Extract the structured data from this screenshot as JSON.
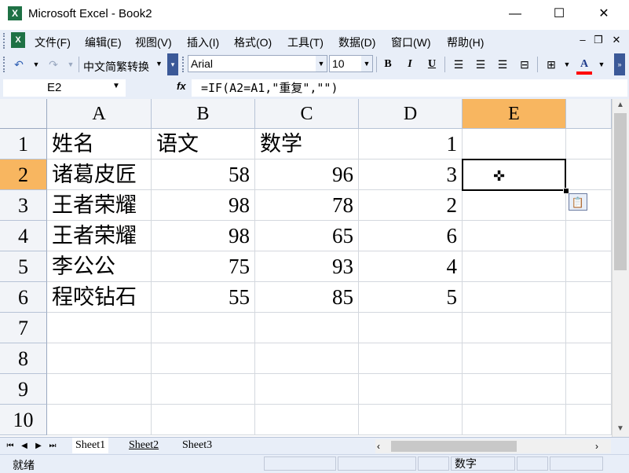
{
  "window": {
    "title": "Microsoft Excel - Book2",
    "app_icon": "excel-icon",
    "minimize_glyph": "—",
    "maximize_glyph": "☐",
    "close_glyph": "✕"
  },
  "menubar": {
    "items": [
      "文件(F)",
      "编辑(E)",
      "视图(V)",
      "插入(I)",
      "格式(O)",
      "工具(T)",
      "数据(D)",
      "窗口(W)",
      "帮助(H)"
    ]
  },
  "toolbar": {
    "undo_glyph": "↶",
    "redo_glyph": "↷",
    "convert_label": "中文简繁转换",
    "font_name": "Arial",
    "font_size": "10",
    "bold": "B",
    "italic": "I",
    "underline": "U",
    "font_color_label": "A",
    "font_color": "#ff0000"
  },
  "formula_bar": {
    "name_box": "E2",
    "fx_label": "fx",
    "formula": "=IF(A2=A1,\"重复\",\"\")"
  },
  "sheet": {
    "columns": [
      "A",
      "B",
      "C",
      "D",
      "E"
    ],
    "selected_column": "E",
    "rows": [
      "1",
      "2",
      "3",
      "4",
      "5",
      "6",
      "7",
      "8",
      "9",
      "10"
    ],
    "selected_row": "2",
    "cells": [
      [
        "姓名",
        "语文",
        "数学",
        "1",
        ""
      ],
      [
        "诸葛皮匠",
        "58",
        "96",
        "3",
        ""
      ],
      [
        "王者荣耀",
        "98",
        "78",
        "2",
        ""
      ],
      [
        "王者荣耀",
        "98",
        "65",
        "6",
        ""
      ],
      [
        "李公公",
        "75",
        "93",
        "4",
        ""
      ],
      [
        "程咬钻石",
        "55",
        "85",
        "5",
        ""
      ]
    ],
    "active_cell": "E2"
  },
  "tabs": {
    "sheets": [
      "Sheet1",
      "Sheet2",
      "Sheet3"
    ],
    "active": "Sheet1"
  },
  "status": {
    "ready": "就绪",
    "num_lock": "数字"
  }
}
